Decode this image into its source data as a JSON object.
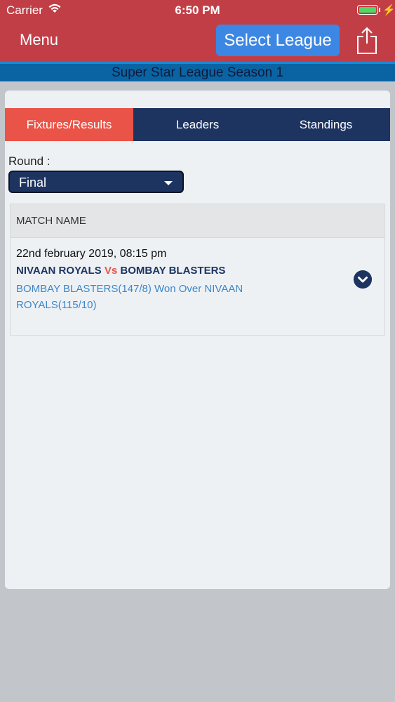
{
  "status_bar": {
    "carrier": "Carrier",
    "time": "6:50 PM",
    "battery_color": "#4cd964"
  },
  "nav": {
    "menu_label": "Menu",
    "select_league_label": "Select League",
    "share_icon": "share-icon"
  },
  "league": {
    "season_title": "Super Star League Season 1"
  },
  "tabs": [
    {
      "label": "Fixtures/Results",
      "active": true
    },
    {
      "label": "Leaders",
      "active": false
    },
    {
      "label": "Standings",
      "active": false
    }
  ],
  "round": {
    "label": "Round :",
    "selected": "Final"
  },
  "table": {
    "header": "MATCH NAME",
    "rows": [
      {
        "date": "22nd february 2019, 08:15 pm",
        "team_a": "NIVAAN ROYALS",
        "vs": "Vs",
        "team_b": "BOMBAY BLASTERS",
        "result": "BOMBAY BLASTERS(147/8) Won Over NIVAAN ROYALS(115/10)"
      }
    ]
  },
  "colors": {
    "header_red": "#c23e46",
    "navy": "#1d3461",
    "active_tab": "#ea5347",
    "accent_blue": "#3b87e3"
  }
}
